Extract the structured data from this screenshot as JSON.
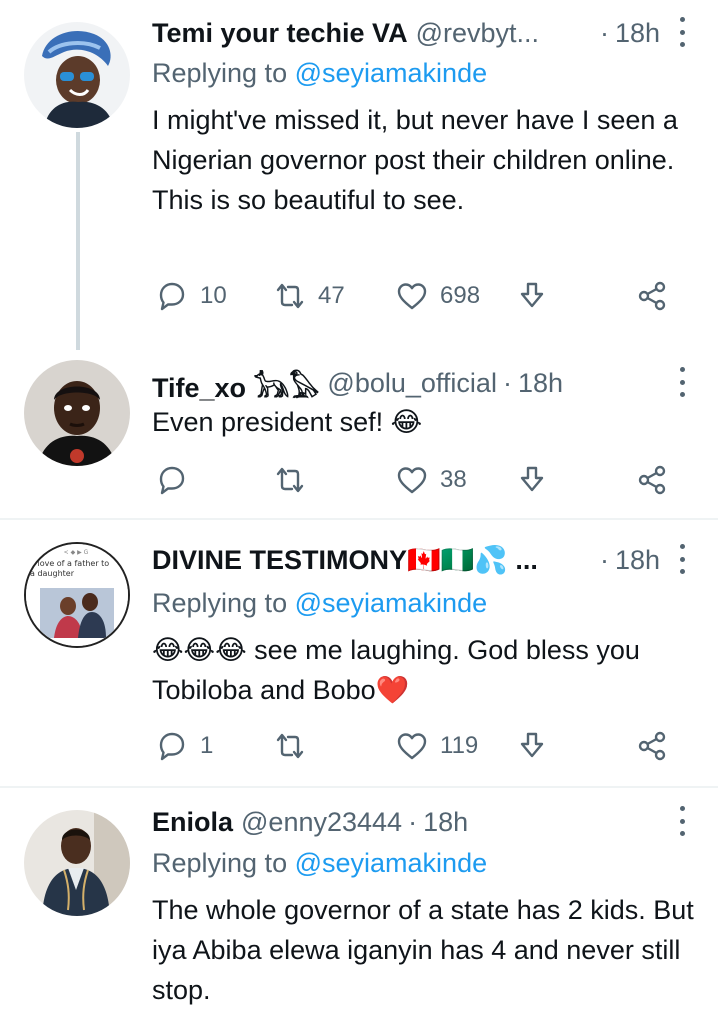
{
  "tweets": [
    {
      "name": "Temi your techie VA",
      "handle": "@revbyt...",
      "time": "18h",
      "reply_prefix": "Replying to",
      "reply_to": "@seyiamakinde",
      "text": "I might've missed it, but never have I seen a Nigerian governor post their children online. This is so beautiful to see.",
      "replies": "10",
      "retweets": "47",
      "likes": "698"
    },
    {
      "name": "Tife_xo 𓃥𓅃",
      "handle": "@bolu_official",
      "time": "18h",
      "text": "Even president sef! 😂",
      "replies": "",
      "retweets": "",
      "likes": "38"
    },
    {
      "name": "DIVINE TESTIMONY🇨🇦🇳🇬💦 ...",
      "handle": "",
      "time": "18h",
      "reply_prefix": "Replying to",
      "reply_to": "@seyiamakinde",
      "text": "😂😂😂 see me laughing. God bless you Tobiloba and Bobo❤️",
      "replies": "1",
      "retweets": "",
      "likes": "119",
      "avatar_caption": "e love of a father to a daughter"
    },
    {
      "name": "Eniola",
      "handle": "@enny23444",
      "time": "18h",
      "reply_prefix": "Replying to",
      "reply_to": "@seyiamakinde",
      "text": "The whole governor of a state has 2 kids. But iya Abiba elewa iganyin has 4 and never still stop."
    }
  ],
  "separator": "·",
  "colors": {
    "link": "#1d9bf0",
    "muted": "#536471",
    "text": "#0f1419",
    "thread_line": "#cfd9de"
  },
  "icons": [
    "reply-icon",
    "retweet-icon",
    "like-icon",
    "bookmark-icon",
    "share-icon",
    "more-icon"
  ]
}
